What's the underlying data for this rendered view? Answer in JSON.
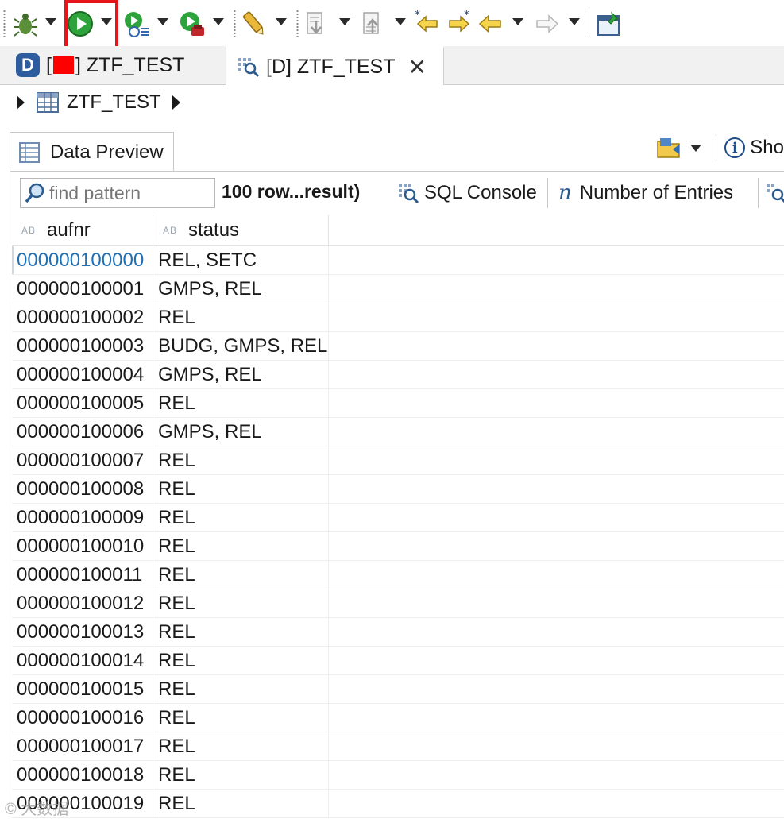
{
  "tabs": [
    {
      "prefix": "[",
      "suffix": "] ZTF_TEST",
      "active": false
    },
    {
      "prefix": "[",
      "suffix": "D] ZTF_TEST",
      "active": true
    }
  ],
  "breadcrumb": {
    "label": "ZTF_TEST"
  },
  "view": {
    "tab_label": "Data Preview",
    "show_label": "Sho"
  },
  "toolbar_row": {
    "search_placeholder": "find pattern",
    "row_count": "100 row...result)",
    "sql_console": "SQL Console",
    "number_of_entries": "Number of Entries"
  },
  "grid": {
    "column_type_tag": "AB",
    "columns": [
      "aufnr",
      "status"
    ],
    "rows": [
      [
        "000000100000",
        "REL, SETC"
      ],
      [
        "000000100001",
        "GMPS, REL"
      ],
      [
        "000000100002",
        "REL"
      ],
      [
        "000000100003",
        "BUDG, GMPS, REL"
      ],
      [
        "000000100004",
        "GMPS, REL"
      ],
      [
        "000000100005",
        "REL"
      ],
      [
        "000000100006",
        "GMPS, REL"
      ],
      [
        "000000100007",
        "REL"
      ],
      [
        "000000100008",
        "REL"
      ],
      [
        "000000100009",
        "REL"
      ],
      [
        "000000100010",
        "REL"
      ],
      [
        "000000100011",
        "REL"
      ],
      [
        "000000100012",
        "REL"
      ],
      [
        "000000100013",
        "REL"
      ],
      [
        "000000100014",
        "REL"
      ],
      [
        "000000100015",
        "REL"
      ],
      [
        "000000100016",
        "REL"
      ],
      [
        "000000100017",
        "REL"
      ],
      [
        "000000100018",
        "REL"
      ],
      [
        "000000100019",
        "REL"
      ]
    ]
  },
  "colors": {
    "highlight": "#e8141b",
    "run_green": "#2fa33b",
    "selected_text": "#1f6fb5"
  },
  "watermark": "© 大数据"
}
